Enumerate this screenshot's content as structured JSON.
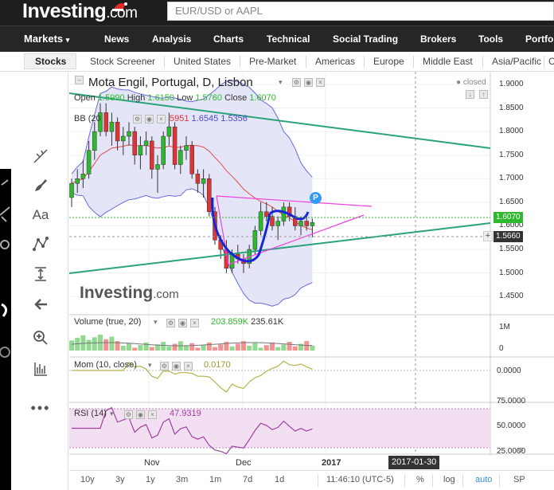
{
  "header": {
    "logo_main": "Investing",
    "logo_suffix": ".com",
    "search_placeholder": "EUR/USD or AAPL"
  },
  "nav": {
    "items": [
      "Markets",
      "News",
      "Analysis",
      "Charts",
      "Technical",
      "Social Trading",
      "Brokers",
      "Tools",
      "Portfo"
    ],
    "markets_caret": "▾"
  },
  "subnav": {
    "items": [
      "Stocks",
      "Stock Screener",
      "United States",
      "Pre-Market",
      "Americas",
      "Europe",
      "Middle East",
      "Asia/Pacific",
      "Ch"
    ]
  },
  "chart": {
    "title": "Mota Engil, Portugal, D, Lisbon",
    "status": "closed",
    "ohlc": {
      "open_label": "Open",
      "open": "1.5990",
      "high_label": "High",
      "high": "1.6150",
      "low_label": "Low",
      "low": "1.5760",
      "close_label": "Close",
      "close": "1.6070"
    },
    "bb": {
      "label": "BB (20",
      "v1": "1.5951",
      "v1_visible": "5951",
      "v2": "1.6545",
      "v3": "1.5356"
    },
    "watermark_main": "Investing",
    "watermark_suffix": ".com",
    "p_marker": "P",
    "price_axis": [
      "1.9000",
      "1.8500",
      "1.8000",
      "1.7500",
      "1.7000",
      "1.6500",
      "1.6000",
      "1.5500",
      "1.5000",
      "1.4500"
    ],
    "current_price": "1.6070",
    "crosshair_price": "1.5660",
    "crosshair_plus": "+",
    "volume": {
      "label": "Volume (true, 20)",
      "v1": "203.859K",
      "v2": "235.61K",
      "axis": [
        "1M",
        "0"
      ]
    },
    "mom": {
      "label": "Mom (10, close)",
      "value": "0.0170",
      "axis": [
        "0.0000"
      ]
    },
    "rsi": {
      "label": "RSI (14)",
      "value": "47.9319",
      "axis": [
        "75.0000",
        "50.0000",
        "25.0000"
      ]
    },
    "x_labels": [
      "Nov",
      "Dec",
      "2017"
    ],
    "crosshair_date": "2017-01-30",
    "colors": {
      "up": "#2eb82e",
      "down": "#e03434",
      "bb_fill": "#dcdcf5",
      "bb_line": "#6a6ae0",
      "mid": "#e44b4b",
      "trend": "#2aa37a",
      "pink": "#ee44dd",
      "cup": "#1525d8",
      "rsi_fill": "#f2dff2",
      "rsi_line": "#a040a0",
      "mom_line": "#b3b34a"
    }
  },
  "chart_data": {
    "type": "candlestick",
    "series": [
      {
        "name": "Candles",
        "values": [
          [
            1.66,
            1.7,
            1.64,
            1.69
          ],
          [
            1.69,
            1.72,
            1.67,
            1.7
          ],
          [
            1.7,
            1.74,
            1.68,
            1.71
          ],
          [
            1.71,
            1.78,
            1.7,
            1.76
          ],
          [
            1.76,
            1.82,
            1.74,
            1.8
          ],
          [
            1.8,
            1.86,
            1.79,
            1.84
          ],
          [
            1.84,
            1.86,
            1.79,
            1.8
          ],
          [
            1.8,
            1.84,
            1.77,
            1.82
          ],
          [
            1.82,
            1.83,
            1.76,
            1.78
          ],
          [
            1.78,
            1.81,
            1.75,
            1.79
          ],
          [
            1.79,
            1.82,
            1.77,
            1.8
          ],
          [
            1.8,
            1.81,
            1.73,
            1.75
          ],
          [
            1.75,
            1.79,
            1.72,
            1.77
          ],
          [
            1.77,
            1.8,
            1.75,
            1.78
          ],
          [
            1.78,
            1.79,
            1.7,
            1.72
          ],
          [
            1.72,
            1.75,
            1.67,
            1.73
          ],
          [
            1.73,
            1.8,
            1.72,
            1.79
          ],
          [
            1.79,
            1.84,
            1.77,
            1.81
          ],
          [
            1.81,
            1.82,
            1.72,
            1.73
          ],
          [
            1.73,
            1.77,
            1.71,
            1.76
          ],
          [
            1.76,
            1.79,
            1.74,
            1.77
          ],
          [
            1.77,
            1.78,
            1.7,
            1.71
          ],
          [
            1.71,
            1.72,
            1.67,
            1.69
          ],
          [
            1.69,
            1.72,
            1.66,
            1.7
          ],
          [
            1.7,
            1.71,
            1.62,
            1.63
          ],
          [
            1.63,
            1.64,
            1.56,
            1.57
          ],
          [
            1.57,
            1.58,
            1.53,
            1.55
          ],
          [
            1.55,
            1.57,
            1.5,
            1.51
          ],
          [
            1.51,
            1.55,
            1.5,
            1.54
          ],
          [
            1.54,
            1.56,
            1.52,
            1.53
          ],
          [
            1.53,
            1.54,
            1.5,
            1.52
          ],
          [
            1.52,
            1.56,
            1.51,
            1.55
          ],
          [
            1.55,
            1.6,
            1.54,
            1.59
          ],
          [
            1.59,
            1.65,
            1.58,
            1.63
          ],
          [
            1.63,
            1.65,
            1.61,
            1.62
          ],
          [
            1.62,
            1.64,
            1.59,
            1.6
          ],
          [
            1.6,
            1.62,
            1.57,
            1.61
          ],
          [
            1.61,
            1.65,
            1.6,
            1.64
          ],
          [
            1.64,
            1.65,
            1.61,
            1.62
          ],
          [
            1.62,
            1.64,
            1.59,
            1.6
          ],
          [
            1.6,
            1.62,
            1.58,
            1.61
          ],
          [
            1.61,
            1.62,
            1.59,
            1.6
          ],
          [
            1.6,
            1.615,
            1.576,
            1.607
          ]
        ]
      }
    ],
    "x_tick_labels": [
      "Nov",
      "Dec",
      "2017"
    ],
    "y_ticks": [
      1.9,
      1.85,
      1.8,
      1.75,
      1.7,
      1.65,
      1.6,
      1.55,
      1.5,
      1.45
    ],
    "ylim": [
      1.42,
      1.91
    ]
  },
  "bottom": {
    "timeframes": [
      "10y",
      "3y",
      "1y",
      "3m",
      "1m",
      "7d",
      "1d"
    ],
    "time": "11:46:10 (UTC-5)",
    "options": [
      "%",
      "log",
      "auto",
      "SP"
    ]
  }
}
